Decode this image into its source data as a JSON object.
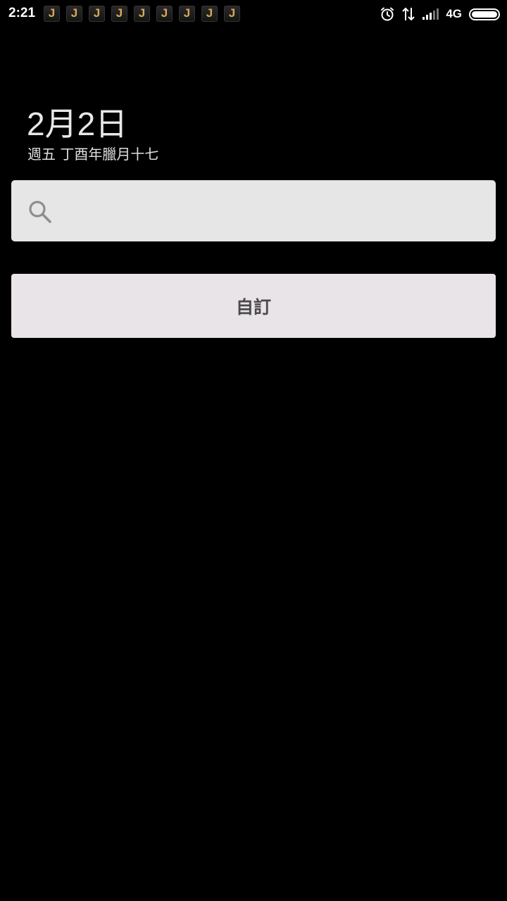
{
  "status_bar": {
    "time": "2:21",
    "notification_icons": [
      "J",
      "J",
      "J",
      "J",
      "J",
      "J",
      "J",
      "J",
      "J"
    ],
    "icons": [
      "alarm-icon",
      "data-arrows-icon",
      "signal-icon",
      "battery-icon"
    ],
    "network": "4G",
    "battery_level": 1.0
  },
  "date": {
    "main": "2月2日",
    "sub": "週五 丁酉年臘月十七"
  },
  "search": {
    "placeholder": "",
    "value": "",
    "icon": "search-icon"
  },
  "customize": {
    "label": "自訂"
  },
  "colors": {
    "background": "#000000",
    "search_box": "#e6e6e6",
    "customize_button": "#e8e4e8",
    "notification_letter": "#d9a85a"
  }
}
